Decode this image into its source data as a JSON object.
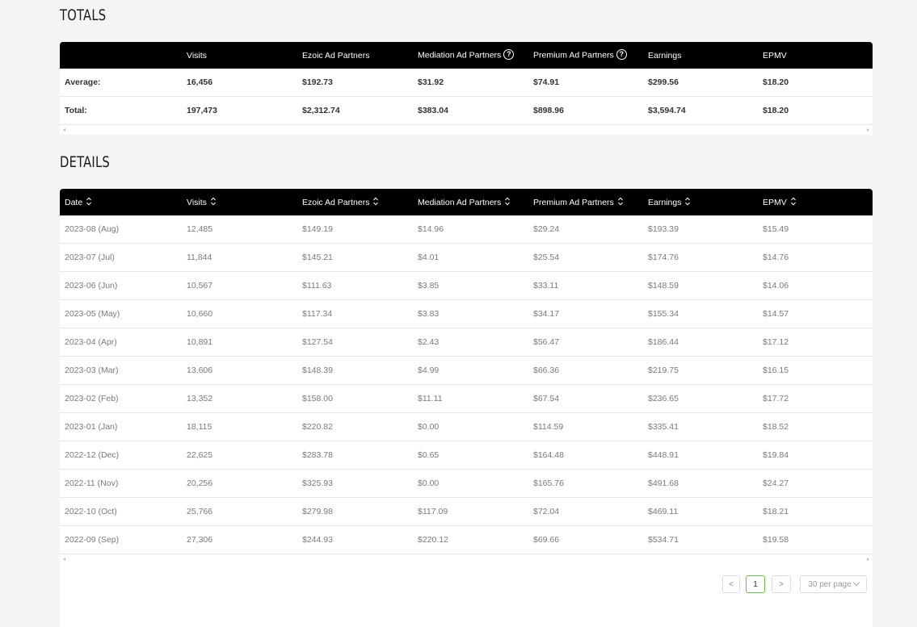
{
  "totals": {
    "title": "TOTALS",
    "headers": [
      "",
      "Visits",
      "Ezoic Ad Partners",
      "Mediation Ad Partners",
      "Premium Ad Partners",
      "Earnings",
      "EPMV"
    ],
    "rows": [
      [
        "Average:",
        "16,456",
        "$192.73",
        "$31.92",
        "$74.91",
        "$299.56",
        "$18.20"
      ],
      [
        "Total:",
        "197,473",
        "$2,312.74",
        "$383.04",
        "$898.96",
        "$3,594.74",
        "$18.20"
      ]
    ]
  },
  "details": {
    "title": "DETAILS",
    "headers": [
      "Date",
      "Visits",
      "Ezoic Ad Partners",
      "Mediation Ad Partners",
      "Premium Ad Partners",
      "Earnings",
      "EPMV"
    ],
    "rows": [
      [
        "2023-08 (Aug)",
        "12,485",
        "$149.19",
        "$14.96",
        "$29.24",
        "$193.39",
        "$15.49"
      ],
      [
        "2023-07 (Jul)",
        "11,844",
        "$145.21",
        "$4.01",
        "$25.54",
        "$174.76",
        "$14.76"
      ],
      [
        "2023-06 (Jun)",
        "10,567",
        "$111.63",
        "$3.85",
        "$33.11",
        "$148.59",
        "$14.06"
      ],
      [
        "2023-05 (May)",
        "10,660",
        "$117.34",
        "$3.83",
        "$34.17",
        "$155.34",
        "$14.57"
      ],
      [
        "2023-04 (Apr)",
        "10,891",
        "$127.54",
        "$2.43",
        "$56.47",
        "$186.44",
        "$17.12"
      ],
      [
        "2023-03 (Mar)",
        "13,606",
        "$148.39",
        "$4.99",
        "$66.36",
        "$219.75",
        "$16.15"
      ],
      [
        "2023-02 (Feb)",
        "13,352",
        "$158.00",
        "$11.11",
        "$67.54",
        "$236.65",
        "$17.72"
      ],
      [
        "2023-01 (Jan)",
        "18,115",
        "$220.82",
        "$0.00",
        "$114.59",
        "$335.41",
        "$18.52"
      ],
      [
        "2022-12 (Dec)",
        "22,625",
        "$283.78",
        "$0.65",
        "$164.48",
        "$448.91",
        "$19.84"
      ],
      [
        "2022-11 (Nov)",
        "20,256",
        "$325.93",
        "$0.00",
        "$165.76",
        "$491.68",
        "$24.27"
      ],
      [
        "2022-10 (Oct)",
        "25,766",
        "$279.98",
        "$117.09",
        "$72.04",
        "$469.11",
        "$18.21"
      ],
      [
        "2022-09 (Sep)",
        "27,306",
        "$244.93",
        "$220.12",
        "$69.66",
        "$534.71",
        "$19.58"
      ]
    ]
  },
  "pagination": {
    "prev": "<",
    "current_page": "1",
    "next": ">",
    "per_page": "30 per page"
  }
}
